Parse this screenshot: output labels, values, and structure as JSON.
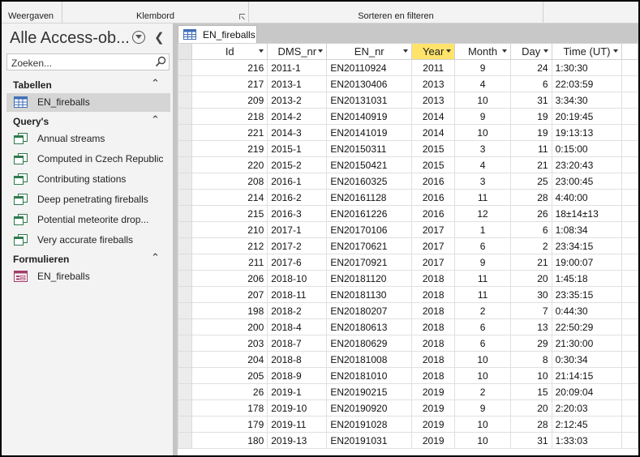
{
  "ribbon": {
    "groups": [
      "Weergaven",
      "Klembord",
      "Sorteren en filteren"
    ]
  },
  "nav": {
    "title": "Alle Access-ob...",
    "search_placeholder": "Zoeken...",
    "sections": [
      {
        "label": "Tabellen",
        "items": [
          {
            "label": "EN_fireballs",
            "icon": "table-icon"
          }
        ]
      },
      {
        "label": "Query's",
        "items": [
          {
            "label": "Annual streams",
            "icon": "query-icon"
          },
          {
            "label": "Computed in Czech Republic",
            "icon": "query-icon"
          },
          {
            "label": "Contributing stations",
            "icon": "query-icon"
          },
          {
            "label": "Deep penetrating fireballs",
            "icon": "query-icon"
          },
          {
            "label": "Potential meteorite drop...",
            "icon": "query-icon"
          },
          {
            "label": "Very accurate fireballs",
            "icon": "query-icon"
          }
        ]
      },
      {
        "label": "Formulieren",
        "items": [
          {
            "label": "EN_fireballs",
            "icon": "form-icon"
          }
        ]
      }
    ]
  },
  "document": {
    "tab_label": "EN_fireballs",
    "columns": [
      "Id",
      "DMS_nr",
      "EN_nr",
      "Year",
      "Month",
      "Day",
      "Time (UT)"
    ],
    "sorted_column": "Year",
    "rows": [
      [
        "216",
        "2011-1",
        "EN20110924",
        "2011",
        "9",
        "24",
        "1:30:30"
      ],
      [
        "217",
        "2013-1",
        "EN20130406",
        "2013",
        "4",
        "6",
        "22:03:59"
      ],
      [
        "209",
        "2013-2",
        "EN20131031",
        "2013",
        "10",
        "31",
        "3:34:30"
      ],
      [
        "218",
        "2014-2",
        "EN20140919",
        "2014",
        "9",
        "19",
        "20:19:45"
      ],
      [
        "221",
        "2014-3",
        "EN20141019",
        "2014",
        "10",
        "19",
        "19:13:13"
      ],
      [
        "219",
        "2015-1",
        "EN20150311",
        "2015",
        "3",
        "11",
        "0:15:00"
      ],
      [
        "220",
        "2015-2",
        "EN20150421",
        "2015",
        "4",
        "21",
        "23:20:43"
      ],
      [
        "208",
        "2016-1",
        "EN20160325",
        "2016",
        "3",
        "25",
        "23:00:45"
      ],
      [
        "214",
        "2016-2",
        "EN20161128",
        "2016",
        "11",
        "28",
        "4:40:00"
      ],
      [
        "215",
        "2016-3",
        "EN20161226",
        "2016",
        "12",
        "26",
        "18±14±13"
      ],
      [
        "210",
        "2017-1",
        "EN20170106",
        "2017",
        "1",
        "6",
        "1:08:34"
      ],
      [
        "212",
        "2017-2",
        "EN20170621",
        "2017",
        "6",
        "2",
        "23:34:15"
      ],
      [
        "211",
        "2017-6",
        "EN20170921",
        "2017",
        "9",
        "21",
        "19:00:07"
      ],
      [
        "206",
        "2018-10",
        "EN20181120",
        "2018",
        "11",
        "20",
        "1:45:18"
      ],
      [
        "207",
        "2018-11",
        "EN20181130",
        "2018",
        "11",
        "30",
        "23:35:15"
      ],
      [
        "198",
        "2018-2",
        "EN20180207",
        "2018",
        "2",
        "7",
        "0:44:30"
      ],
      [
        "200",
        "2018-4",
        "EN20180613",
        "2018",
        "6",
        "13",
        "22:50:29"
      ],
      [
        "203",
        "2018-7",
        "EN20180629",
        "2018",
        "6",
        "29",
        "21:30:00"
      ],
      [
        "204",
        "2018-8",
        "EN20181008",
        "2018",
        "10",
        "8",
        "0:30:34"
      ],
      [
        "205",
        "2018-9",
        "EN20181010",
        "2018",
        "10",
        "10",
        "21:14:15"
      ],
      [
        "26",
        "2019-1",
        "EN20190215",
        "2019",
        "2",
        "15",
        "20:09:04"
      ],
      [
        "178",
        "2019-10",
        "EN20190920",
        "2019",
        "9",
        "20",
        "2:20:03"
      ],
      [
        "179",
        "2019-11",
        "EN20191028",
        "2019",
        "10",
        "28",
        "2:12:45"
      ],
      [
        "180",
        "2019-13",
        "EN20191031",
        "2019",
        "10",
        "31",
        "1:33:03"
      ]
    ]
  },
  "colors": {
    "sorted_header": "#ffe36b",
    "selected_item": "#d5d5d5"
  }
}
